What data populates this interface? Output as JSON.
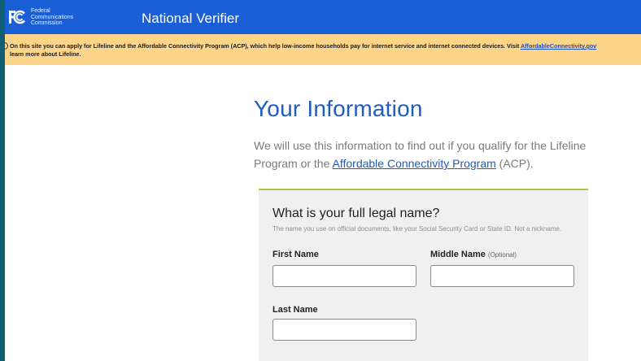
{
  "header": {
    "org_lines": [
      "Federal",
      "Communications",
      "Commission"
    ],
    "logo_text": "FCC",
    "app_title": "National Verifier"
  },
  "banner": {
    "text_before_link": "On this site you can apply for Lifeline and the Affordable Connectivity Program (ACP), which help low-income households pay for internet service and internet connected devices. Visit ",
    "link_text": "AffordableConnectivity.gov",
    "text_after_link": "learn more about Lifeline."
  },
  "main": {
    "heading": "Your Information",
    "intro_before_link": "We will use this information to find out if you qualify for the Lifeline Program or the ",
    "intro_link": "Affordable Connectivity Program",
    "intro_after_link": " (ACP)."
  },
  "name_form": {
    "question": "What is your full legal name?",
    "help_text": "The name you use on official documents, like your Social Security Card or State ID. Not a nickname.",
    "first_name_label": "First Name",
    "middle_name_label": "Middle Name",
    "middle_name_optional": "(Optional)",
    "last_name_label": "Last Name",
    "first_name_value": "",
    "middle_name_value": "",
    "last_name_value": ""
  },
  "colors": {
    "header_bg": "#1a5fd6",
    "banner_bg": "#fcd48a",
    "heading": "#1f5cc0",
    "card_accent": "#b5bf3f",
    "outer_bg": "#0f5e74"
  }
}
